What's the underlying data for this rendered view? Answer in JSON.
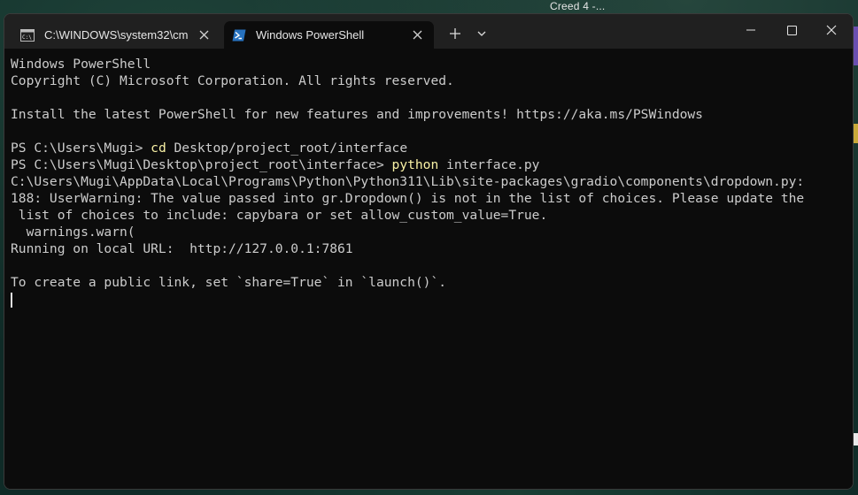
{
  "desktop": {
    "top_label": "Creed 4 -..."
  },
  "tabs": [
    {
      "label": "C:\\WINDOWS\\system32\\cm",
      "icon": "cmd-icon",
      "active": false
    },
    {
      "label": "Windows PowerShell",
      "icon": "powershell-icon",
      "active": true
    }
  ],
  "titlebar": {
    "new_tab_icon": "plus-icon",
    "dropdown_icon": "chevron-down-icon",
    "minimize_icon": "minimize-icon",
    "maximize_icon": "maximize-icon",
    "close_icon": "close-icon"
  },
  "terminal": {
    "lines": [
      "Windows PowerShell",
      "Copyright (C) Microsoft Corporation. All rights reserved.",
      "",
      "Install the latest PowerShell for new features and improvements! https://aka.ms/PSWindows",
      ""
    ],
    "cmd1_prompt": "PS C:\\Users\\Mugi> ",
    "cmd1_command": "cd",
    "cmd1_args": " Desktop/project_root/interface",
    "cmd2_prompt": "PS C:\\Users\\Mugi\\Desktop\\project_root\\interface> ",
    "cmd2_command": "python",
    "cmd2_args": " interface.py",
    "output": [
      "C:\\Users\\Mugi\\AppData\\Local\\Programs\\Python\\Python311\\Lib\\site-packages\\gradio\\components\\dropdown.py:",
      "188: UserWarning: The value passed into gr.Dropdown() is not in the list of choices. Please update the",
      " list of choices to include: capybara or set allow_custom_value=True.",
      "  warnings.warn(",
      "Running on local URL:  http://127.0.0.1:7861",
      "",
      "To create a public link, set `share=True` in `launch()`."
    ]
  },
  "colors": {
    "command_highlight": "#f9f1a5",
    "terminal_text": "#cccccc",
    "terminal_bg": "#0c0c0c",
    "titlebar_bg": "#202020"
  }
}
